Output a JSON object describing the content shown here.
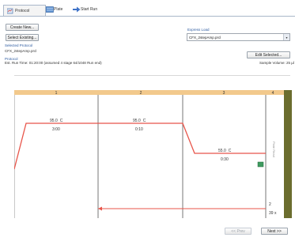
{
  "tabs": [
    {
      "label": "Protocol",
      "icon": "protocol-icon",
      "active": true
    },
    {
      "label": "Plate",
      "icon": "plate-icon",
      "active": false
    },
    {
      "label": "Start Run",
      "icon": "start-run-icon",
      "active": false
    }
  ],
  "top": {
    "create_new": "Create New...",
    "select_existing": "Select Existing...",
    "selected_protocol_label": "Selected Protocol",
    "protocol_file": "CFX_2stepAmp.prcl",
    "protocol_header": "Protocol",
    "est_run_time": "Est. Run Time: 01:20:00   (assumed 4 stage 64/1048 Run end)",
    "sample_volume": "Sample Volume: 25 µl",
    "edit_selected": "Edit Selected...",
    "express_load_label": "Express Load",
    "express_load_value": "CFX_2stepAmp.prcl"
  },
  "chart_data": {
    "type": "protocol-steps",
    "steps": [
      {
        "number": "1",
        "temp": "95.0",
        "unit": "C",
        "time": "3:00"
      },
      {
        "number": "2",
        "temp": "95.0",
        "unit": "C",
        "time": "0:10"
      },
      {
        "number": "3",
        "temp": "55.0",
        "unit": "C",
        "time": "0:30"
      },
      {
        "number": "4",
        "temp": "",
        "unit": "",
        "time": ""
      }
    ],
    "goto_step": "2",
    "goto_count": "39 x",
    "vertical_label": "Plate Read"
  },
  "footer": {
    "prev": "<< Prev",
    "next": "Next >>"
  },
  "colors": {
    "accent": "#2c5aa0",
    "line": "#e8554a",
    "band": "#f2c98c",
    "scroll": "#6b6d2e"
  }
}
